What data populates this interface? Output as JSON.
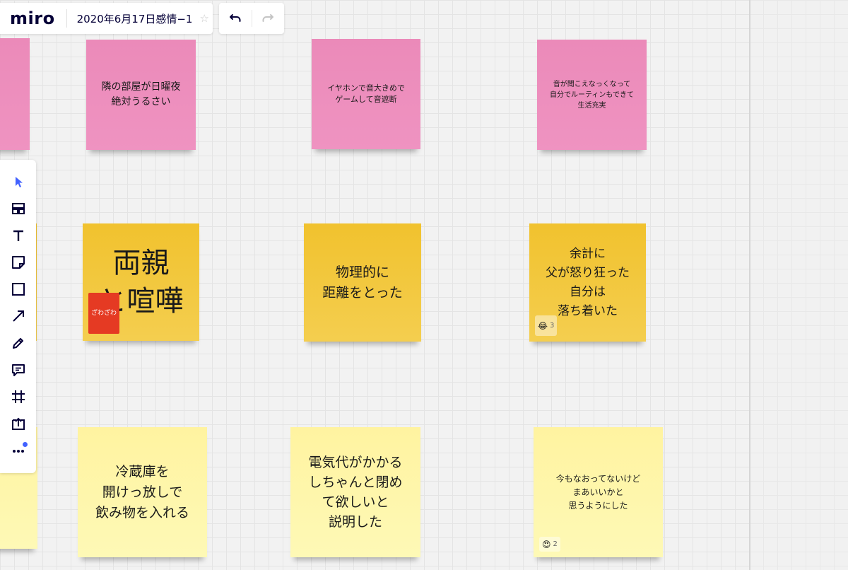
{
  "board": {
    "logo": "miro",
    "title": "2020年6月17日感情−1",
    "star_icon": "star-icon"
  },
  "toolbar": {
    "tools": [
      {
        "name": "select-tool",
        "icon": "cursor-arrow-icon",
        "active": true
      },
      {
        "name": "templates-tool",
        "icon": "templates-icon"
      },
      {
        "name": "text-tool",
        "icon": "text-icon"
      },
      {
        "name": "sticky-note-tool",
        "icon": "sticky-note-icon"
      },
      {
        "name": "shape-tool",
        "icon": "rectangle-icon"
      },
      {
        "name": "line-tool",
        "icon": "arrow-icon"
      },
      {
        "name": "pen-tool",
        "icon": "pen-icon"
      },
      {
        "name": "comment-tool",
        "icon": "comment-icon"
      },
      {
        "name": "frame-tool",
        "icon": "frame-icon"
      },
      {
        "name": "upload-tool",
        "icon": "upload-icon"
      },
      {
        "name": "more-tools",
        "icon": "more-dots-icon",
        "notification": true
      }
    ],
    "accent": "#4262ff"
  },
  "notes": [
    {
      "color": "pink",
      "text": "隣の部屋が日曜夜\n絶対うるさい"
    },
    {
      "color": "pink",
      "text": "イヤホンで音大きめで\nゲームして音遮断"
    },
    {
      "color": "pink",
      "text": "音が聞こえなっくなって\n自分でルーティンもできて\n生活充実"
    },
    {
      "color": "orange",
      "text": "両親\nと喧嘩",
      "tag": "ざわざわ"
    },
    {
      "color": "orange",
      "text": "物理的に\n距離をとった"
    },
    {
      "color": "orange",
      "text": "余計に\n父が怒り狂った\n自分は\n落ち着いた",
      "reaction": {
        "emoji": "😂",
        "count": "3"
      }
    },
    {
      "color": "yellow",
      "text": "冷蔵庫を\n開けっ放しで\n飲み物を入れる"
    },
    {
      "color": "yellow",
      "text": "電気代がかかる\nしちゃんと閉め\nて欲しいと\n説明した"
    },
    {
      "color": "yellow",
      "text": "今もなおってないけど\nまあいいかと\n思うようにした",
      "reaction": {
        "emoji": "😍",
        "count": "2"
      }
    }
  ],
  "colors": {
    "pink": "#ee8dbd",
    "orange": "#f2c63c",
    "yellow": "#fef6ac",
    "tag": "#e53a23"
  }
}
